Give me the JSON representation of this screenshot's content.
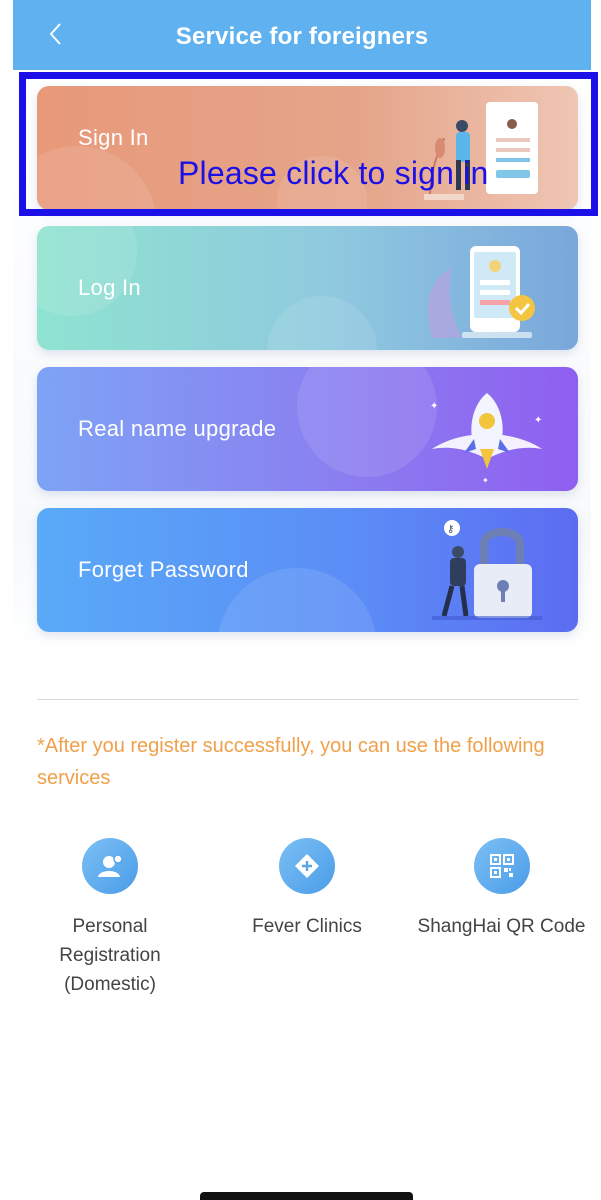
{
  "header": {
    "title": "Service for foreigners",
    "back_icon": "chevron-left-icon"
  },
  "cards": [
    {
      "label": "Sign In",
      "illustration": "person-with-document-icon"
    },
    {
      "label": "Log In",
      "illustration": "phone-with-check-icon"
    },
    {
      "label": "Real name upgrade",
      "illustration": "rocket-icon"
    },
    {
      "label": "Forget Password",
      "illustration": "person-with-padlock-icon"
    }
  ],
  "highlight": {
    "text": "Please click to sign in",
    "color": "#1c10e8"
  },
  "notice": "*After you register successfully, you can use the following services",
  "services": [
    {
      "label": "Personal Registration (Domestic)",
      "icon": "person-badge-icon"
    },
    {
      "label": "Fever Clinics",
      "icon": "plus-shield-icon"
    },
    {
      "label": "ShangHai QR Code",
      "icon": "qr-code-icon"
    }
  ],
  "colors": {
    "header": "#5fb2ef",
    "notice": "#f0a04a",
    "service_icon": "#4a9ce8"
  }
}
